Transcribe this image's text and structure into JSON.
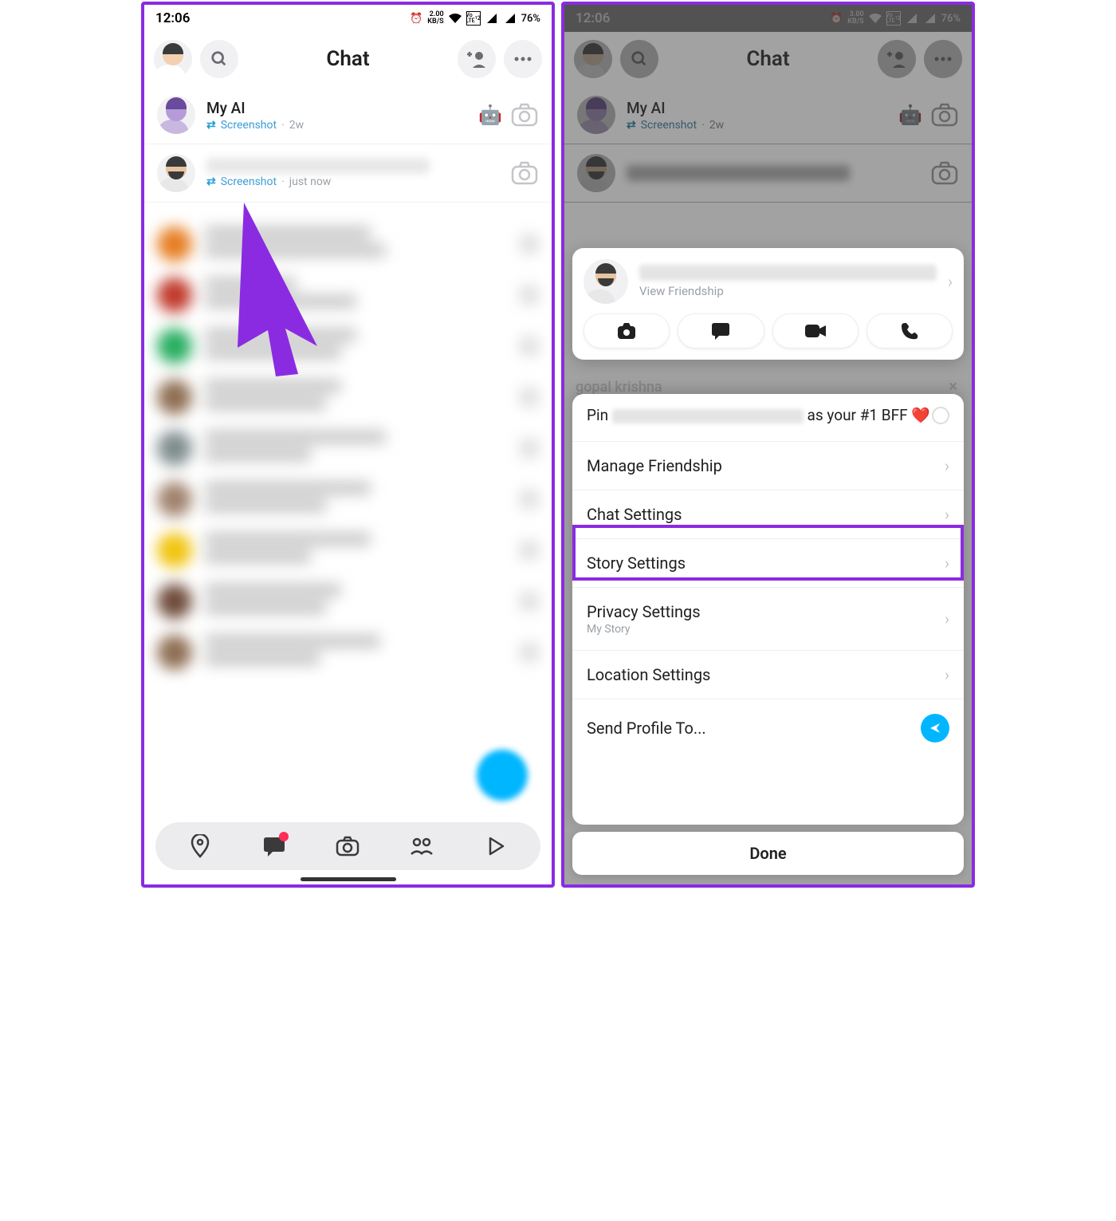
{
  "status": {
    "time": "12:06",
    "speed_left": "2.00",
    "speed_right": "3.00",
    "speed_unit": "KB/S",
    "battery": "76%"
  },
  "header": {
    "title": "Chat"
  },
  "chat": {
    "rows": [
      {
        "name": "My AI",
        "status_icon": "screenshot-icon",
        "status": "Screenshot",
        "time": "2w",
        "emoji": "🤖"
      },
      {
        "name": "",
        "status_icon": "screenshot-icon",
        "status": "Screenshot",
        "time": "just now",
        "emoji": ""
      }
    ]
  },
  "friend_card": {
    "view_friendship": "View Friendship",
    "peek_name": "gopal krishna"
  },
  "sheet": {
    "pin_prefix": "Pin",
    "pin_suffix": "as your #1 BFF ❤️",
    "items": [
      {
        "label": "Manage Friendship",
        "sub": ""
      },
      {
        "label": "Chat Settings",
        "sub": ""
      },
      {
        "label": "Story Settings",
        "sub": ""
      },
      {
        "label": "Privacy Settings",
        "sub": "My Story"
      },
      {
        "label": "Location Settings",
        "sub": ""
      },
      {
        "label": "Send Profile To...",
        "sub": ""
      }
    ],
    "done": "Done"
  }
}
